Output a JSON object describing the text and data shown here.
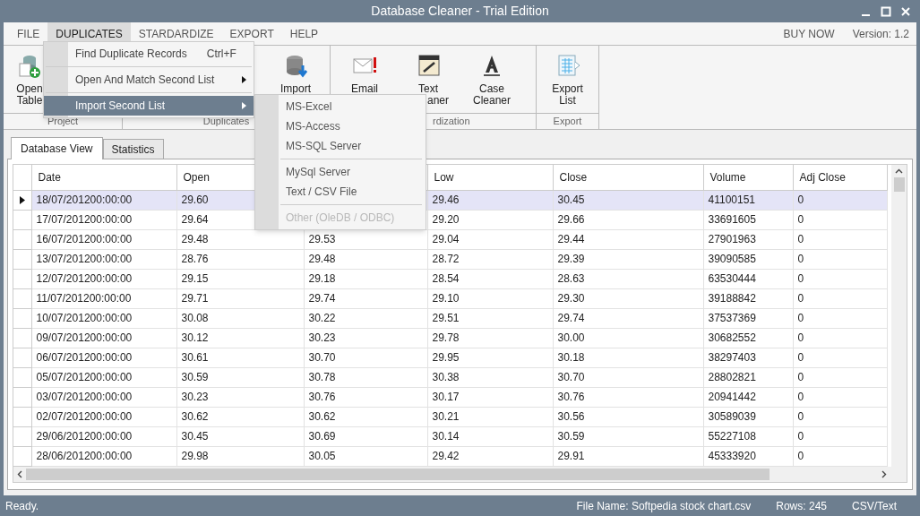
{
  "window": {
    "title": "Database Cleaner - Trial Edition"
  },
  "menu_bar": {
    "items": [
      {
        "label": "FILE",
        "selected": false
      },
      {
        "label": "DUPLICATES",
        "selected": true
      },
      {
        "label": "STARDARDIZE",
        "selected": false
      },
      {
        "label": "EXPORT",
        "selected": false
      },
      {
        "label": "HELP",
        "selected": false
      }
    ],
    "buy_now": "BUY NOW",
    "version": "Version: 1.2"
  },
  "ribbon": {
    "groups": [
      {
        "label": "Project",
        "buttons": [
          {
            "lines": [
              "Open",
              "Table"
            ]
          }
        ]
      },
      {
        "label": "Duplicates",
        "buttons": [
          {
            "lines": [
              "Import"
            ]
          }
        ]
      },
      {
        "label": "rdization",
        "buttons": [
          {
            "lines": [
              "Email"
            ]
          },
          {
            "lines": [
              "Text",
              "aner"
            ]
          },
          {
            "lines": [
              "Case",
              "Cleaner"
            ]
          }
        ]
      },
      {
        "label": "Export",
        "buttons": [
          {
            "lines": [
              "Export",
              "List"
            ]
          }
        ]
      }
    ]
  },
  "duplicates_menu": [
    {
      "kind": "item",
      "label": "Find Duplicate Records",
      "shortcut": "Ctrl+F",
      "submenu": false,
      "selected": false
    },
    {
      "kind": "separator"
    },
    {
      "kind": "item",
      "label": "Open And Match Second List",
      "submenu": true,
      "selected": false
    },
    {
      "kind": "separator"
    },
    {
      "kind": "item",
      "label": "Import Second List",
      "submenu": true,
      "selected": true
    }
  ],
  "import_submenu": [
    {
      "kind": "item",
      "label": "MS-Excel",
      "disabled": false
    },
    {
      "kind": "item",
      "label": "MS-Access",
      "disabled": false
    },
    {
      "kind": "item",
      "label": "MS-SQL Server",
      "disabled": false
    },
    {
      "kind": "separator"
    },
    {
      "kind": "item",
      "label": "MySql Server",
      "disabled": false
    },
    {
      "kind": "item",
      "label": "Text / CSV File",
      "disabled": false
    },
    {
      "kind": "separator"
    },
    {
      "kind": "item",
      "label": "Other (OleDB / ODBC)",
      "disabled": true
    }
  ],
  "tabs": [
    {
      "label": "Database View",
      "selected": true
    },
    {
      "label": "Statistics",
      "selected": false
    }
  ],
  "table": {
    "columns": [
      {
        "label": "Date"
      },
      {
        "label": "Open"
      },
      {},
      {
        "label": "Low"
      },
      {
        "label": "Close"
      },
      {
        "label": "Volume"
      },
      {
        "label": "Adj Close"
      }
    ],
    "rows": [
      {
        "selected": true,
        "cells": [
          "18/07/201200:00:00",
          "29.60",
          null,
          "29.46",
          "30.45",
          "41100151",
          "0"
        ]
      },
      {
        "selected": false,
        "cells": [
          "17/07/201200:00:00",
          "29.64",
          null,
          "29.20",
          "29.66",
          "33691605",
          "0"
        ]
      },
      {
        "selected": false,
        "cells": [
          "16/07/201200:00:00",
          "29.48",
          "29.53",
          "29.04",
          "29.44",
          "27901963",
          "0"
        ]
      },
      {
        "selected": false,
        "cells": [
          "13/07/201200:00:00",
          "28.76",
          "29.48",
          "28.72",
          "29.39",
          "39090585",
          "0"
        ]
      },
      {
        "selected": false,
        "cells": [
          "12/07/201200:00:00",
          "29.15",
          "29.18",
          "28.54",
          "28.63",
          "63530444",
          "0"
        ]
      },
      {
        "selected": false,
        "cells": [
          "11/07/201200:00:00",
          "29.71",
          "29.74",
          "29.10",
          "29.30",
          "39188842",
          "0"
        ]
      },
      {
        "selected": false,
        "cells": [
          "10/07/201200:00:00",
          "30.08",
          "30.22",
          "29.51",
          "29.74",
          "37537369",
          "0"
        ]
      },
      {
        "selected": false,
        "cells": [
          "09/07/201200:00:00",
          "30.12",
          "30.23",
          "29.78",
          "30.00",
          "30682552",
          "0"
        ]
      },
      {
        "selected": false,
        "cells": [
          "06/07/201200:00:00",
          "30.61",
          "30.70",
          "29.95",
          "30.18",
          "38297403",
          "0"
        ]
      },
      {
        "selected": false,
        "cells": [
          "05/07/201200:00:00",
          "30.59",
          "30.78",
          "30.38",
          "30.70",
          "28802821",
          "0"
        ]
      },
      {
        "selected": false,
        "cells": [
          "03/07/201200:00:00",
          "30.23",
          "30.76",
          "30.17",
          "30.76",
          "20941442",
          "0"
        ]
      },
      {
        "selected": false,
        "cells": [
          "02/07/201200:00:00",
          "30.62",
          "30.62",
          "30.21",
          "30.56",
          "30589039",
          "0"
        ]
      },
      {
        "selected": false,
        "cells": [
          "29/06/201200:00:00",
          "30.45",
          "30.69",
          "30.14",
          "30.59",
          "55227108",
          "0"
        ]
      },
      {
        "selected": false,
        "cells": [
          "28/06/201200:00:00",
          "29.98",
          "30.05",
          "29.42",
          "29.91",
          "45333920",
          "0"
        ]
      }
    ]
  },
  "status_bar": {
    "message": "Ready.",
    "file_name": "File Name: Softpedia stock chart.csv",
    "rows": "Rows: 245",
    "format": "CSV/Text"
  }
}
